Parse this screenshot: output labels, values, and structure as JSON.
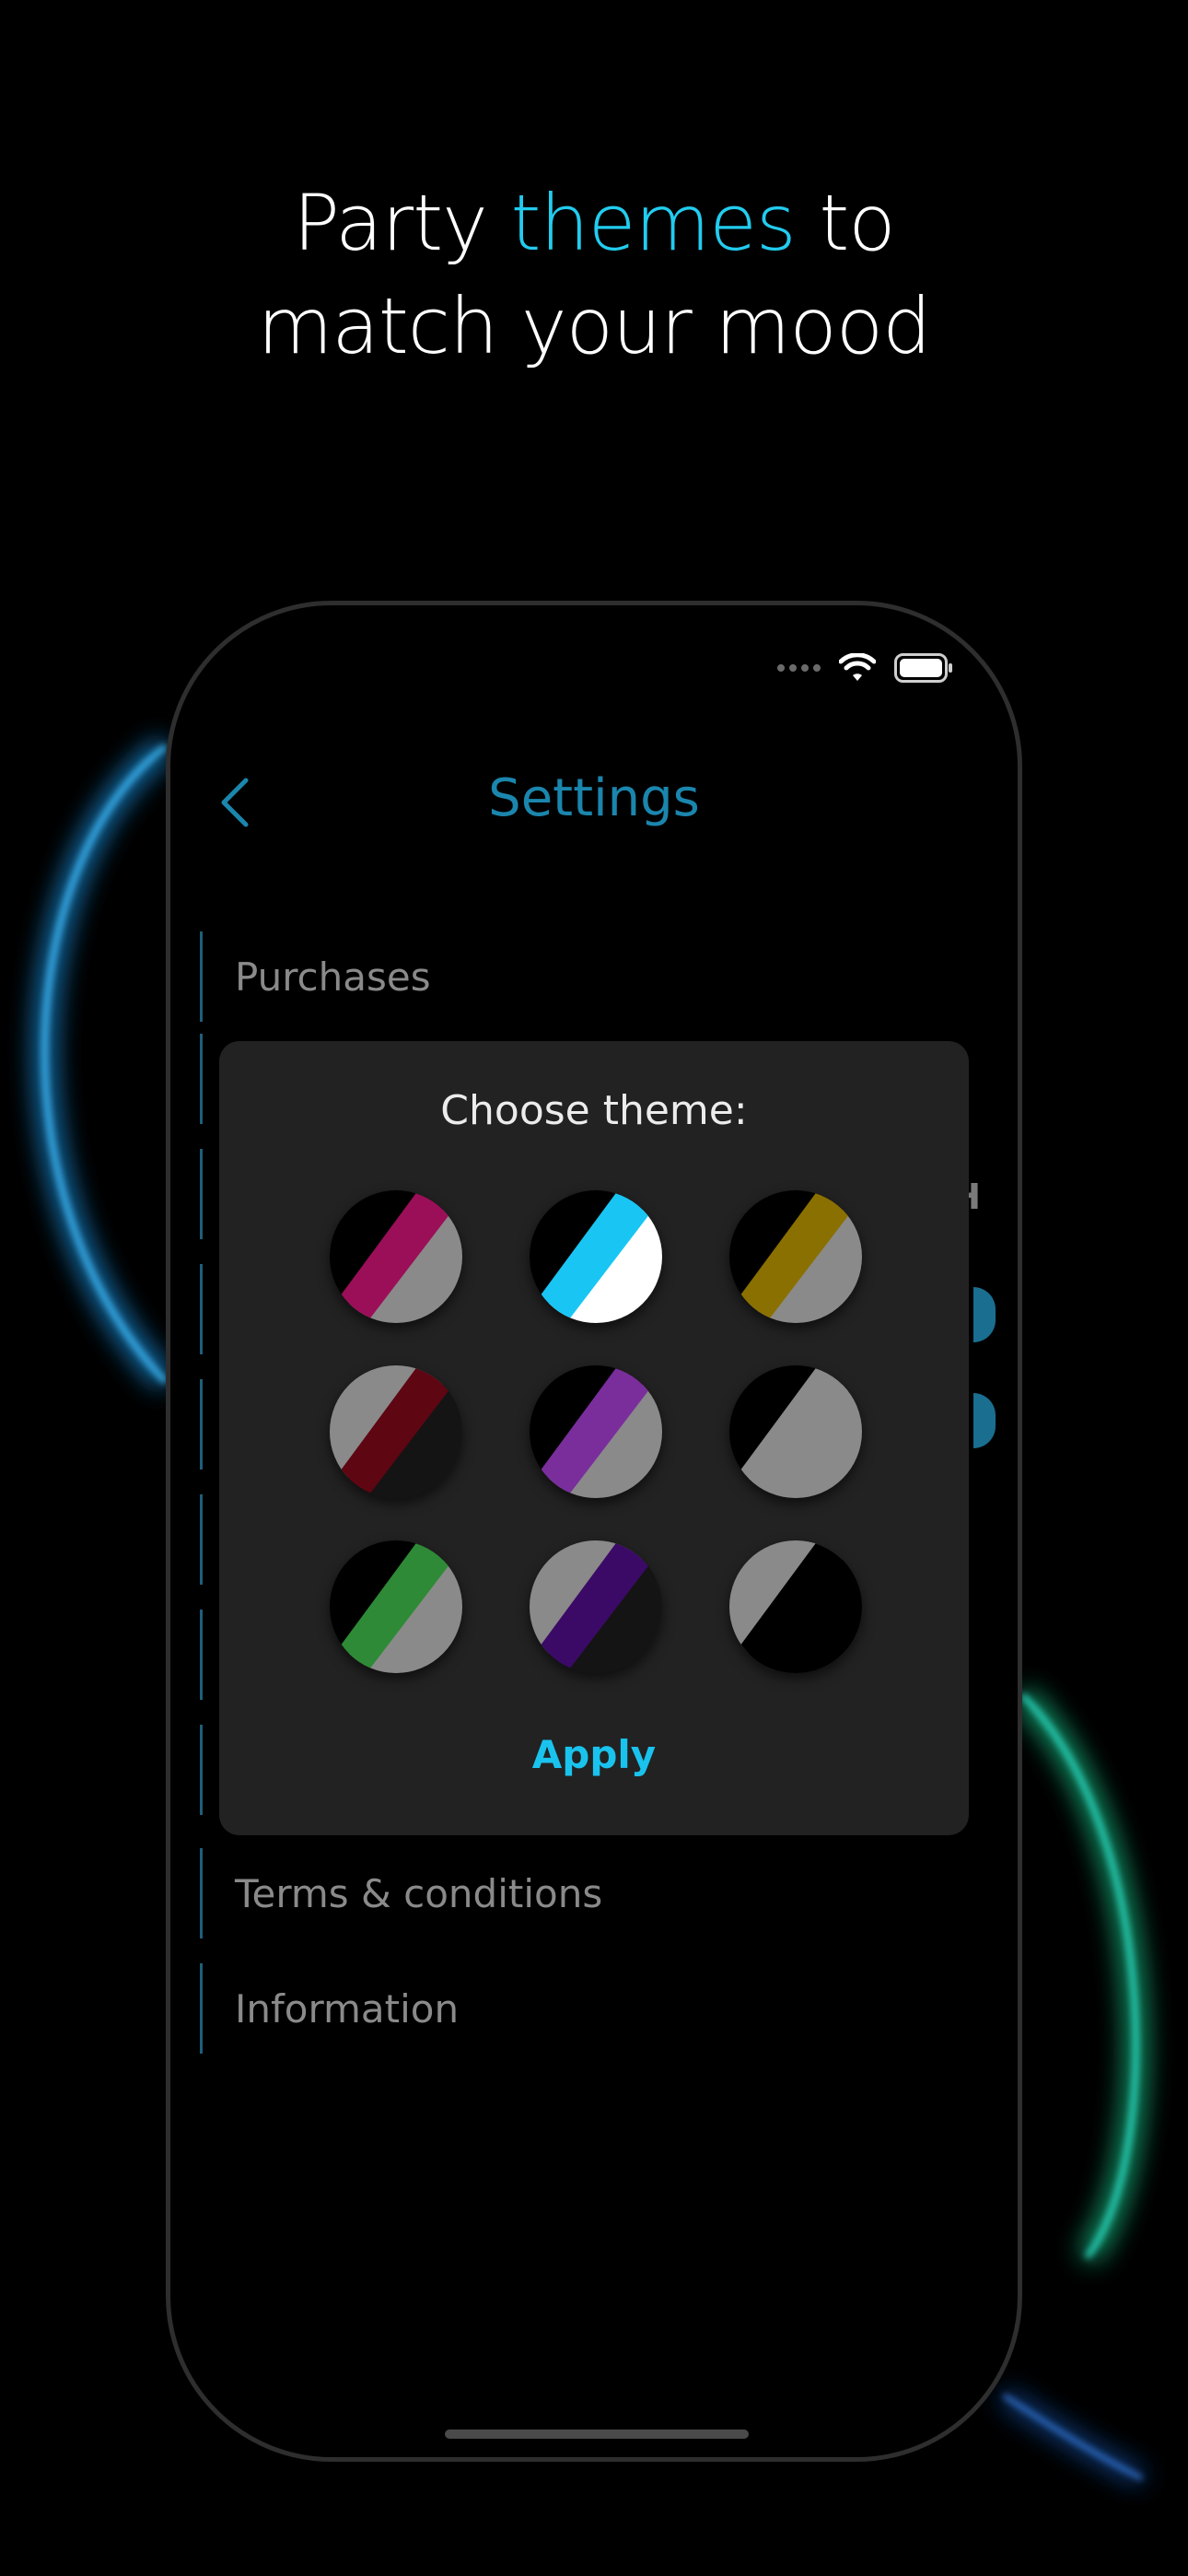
{
  "headline": {
    "part1": "Party ",
    "accent": "themes",
    "part2": " to",
    "line2": "match your mood"
  },
  "colors": {
    "accent": "#22ccef",
    "title": "#1b86ad",
    "apply": "#19c3ee",
    "modal_bg": "#222222",
    "glow_blue": "#1ea6ff",
    "glow_green": "#1fe6a0"
  },
  "status_bar": {
    "icons": [
      "signal-dots-icon",
      "wifi-icon",
      "battery-icon"
    ]
  },
  "nav": {
    "back_icon": "chevron-left-icon",
    "title": "Settings"
  },
  "settings": {
    "items": [
      {
        "label": "Purchases"
      },
      {
        "label": "Terms & conditions"
      },
      {
        "label": "Information"
      }
    ],
    "edge_glyph": "H"
  },
  "theme_modal": {
    "title": "Choose theme:",
    "apply_label": "Apply",
    "themes": [
      {
        "name": "magenta",
        "top": "#000000",
        "stripe": "#9a0f58",
        "bottom": "#8a8a8a"
      },
      {
        "name": "cyan",
        "top": "#000000",
        "stripe": "#19c6f3",
        "bottom": "#ffffff"
      },
      {
        "name": "gold",
        "top": "#000000",
        "stripe": "#8a7000",
        "bottom": "#8a8a8a"
      },
      {
        "name": "crimson",
        "top": "#8a8a8a",
        "stripe": "#5e0612",
        "bottom": "#141414"
      },
      {
        "name": "purple",
        "top": "#000000",
        "stripe": "#7a2e9c",
        "bottom": "#8a8a8a"
      },
      {
        "name": "mono-grey",
        "top": "#000000",
        "stripe": "#8a8a8a",
        "bottom": "#8a8a8a"
      },
      {
        "name": "green",
        "top": "#000000",
        "stripe": "#2e8a36",
        "bottom": "#8a8a8a"
      },
      {
        "name": "indigo",
        "top": "#8a8a8a",
        "stripe": "#3b0a66",
        "bottom": "#141414"
      },
      {
        "name": "mono-black",
        "top": "#8a8a8a",
        "stripe": "#000000",
        "bottom": "#000000"
      }
    ]
  }
}
